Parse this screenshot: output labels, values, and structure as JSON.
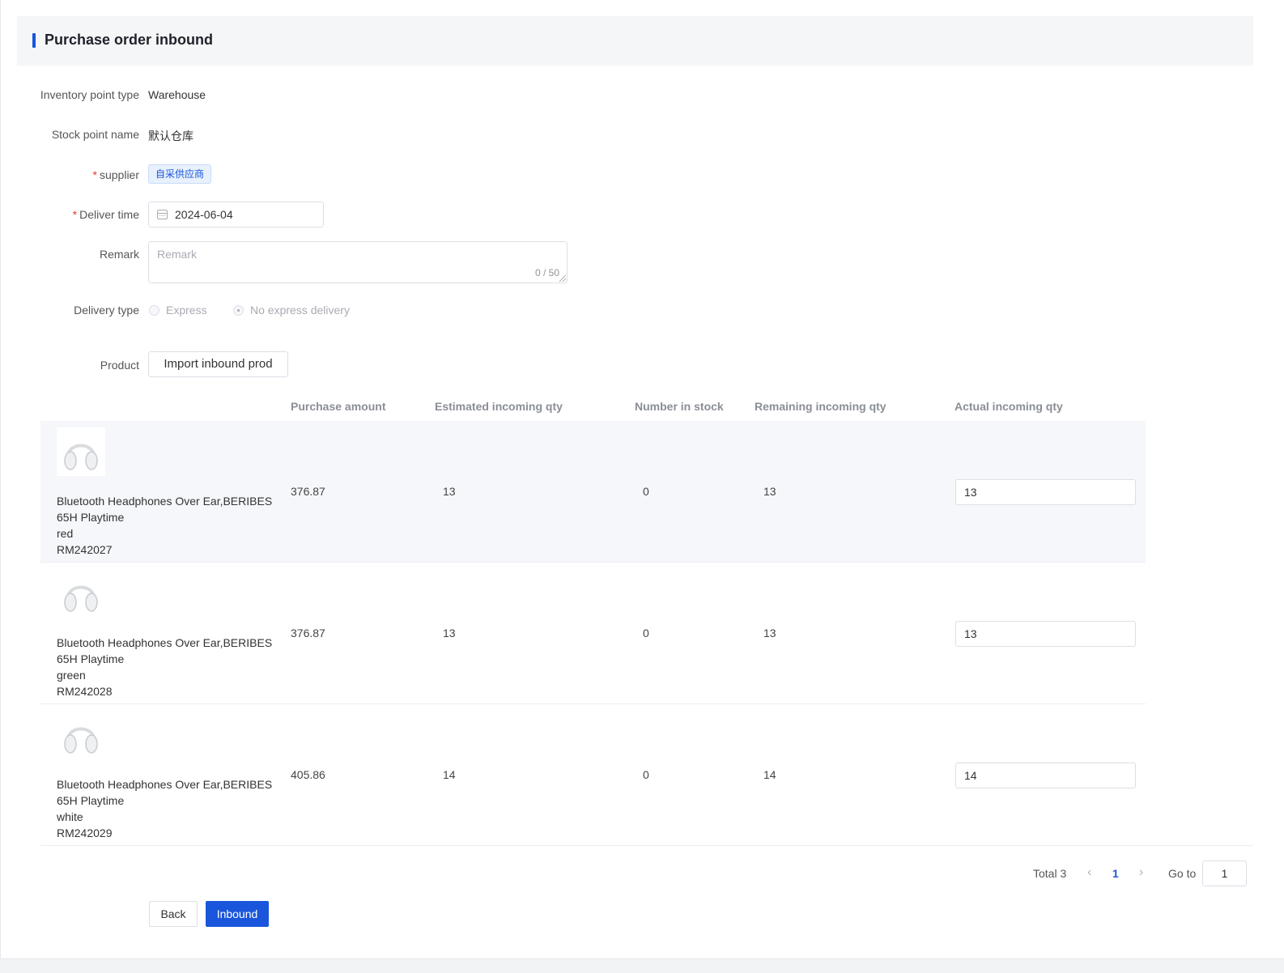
{
  "header": {
    "title": "Purchase order inbound"
  },
  "form": {
    "inventory_point_type": {
      "label": "Inventory point type",
      "value": "Warehouse"
    },
    "stock_point_name": {
      "label": "Stock point name",
      "value": "默认仓库"
    },
    "supplier": {
      "required_mark": "*",
      "label": "supplier",
      "tag": "自采供应商"
    },
    "deliver_time": {
      "required_mark": "*",
      "label": "Deliver time",
      "value": "2024-06-04"
    },
    "remark": {
      "label": "Remark",
      "placeholder": "Remark",
      "count": "0 / 50"
    },
    "delivery_type": {
      "label": "Delivery type",
      "options": [
        "Express",
        "No express delivery"
      ],
      "selected": "No express delivery"
    },
    "product": {
      "label": "Product",
      "import_button": "Import inbound prod"
    }
  },
  "table": {
    "columns": [
      "Purchase amount",
      "Estimated incoming qty",
      "Number in stock",
      "Remaining incoming qty",
      "Actual incoming qty"
    ],
    "rows": [
      {
        "name": "Bluetooth Headphones Over Ear,BERIBES 65H Playtime",
        "color": "red",
        "sku": "RM242027",
        "purchase_amount": "376.87",
        "estimated_qty": "13",
        "in_stock": "0",
        "remaining_qty": "13",
        "actual_qty": "13"
      },
      {
        "name": "Bluetooth Headphones Over Ear,BERIBES 65H Playtime",
        "color": "green",
        "sku": "RM242028",
        "purchase_amount": "376.87",
        "estimated_qty": "13",
        "in_stock": "0",
        "remaining_qty": "13",
        "actual_qty": "13"
      },
      {
        "name": "Bluetooth Headphones Over Ear,BERIBES 65H Playtime",
        "color": "white",
        "sku": "RM242029",
        "purchase_amount": "405.86",
        "estimated_qty": "14",
        "in_stock": "0",
        "remaining_qty": "14",
        "actual_qty": "14"
      }
    ]
  },
  "pagination": {
    "total": "Total 3",
    "current_page": "1",
    "goto_label": "Go to",
    "goto_value": "1",
    "prev_icon": "‹",
    "next_icon": "›"
  },
  "actions": {
    "back": "Back",
    "inbound": "Inbound"
  },
  "colors": {
    "accent": "#1a56db",
    "required": "#e03e2d"
  }
}
